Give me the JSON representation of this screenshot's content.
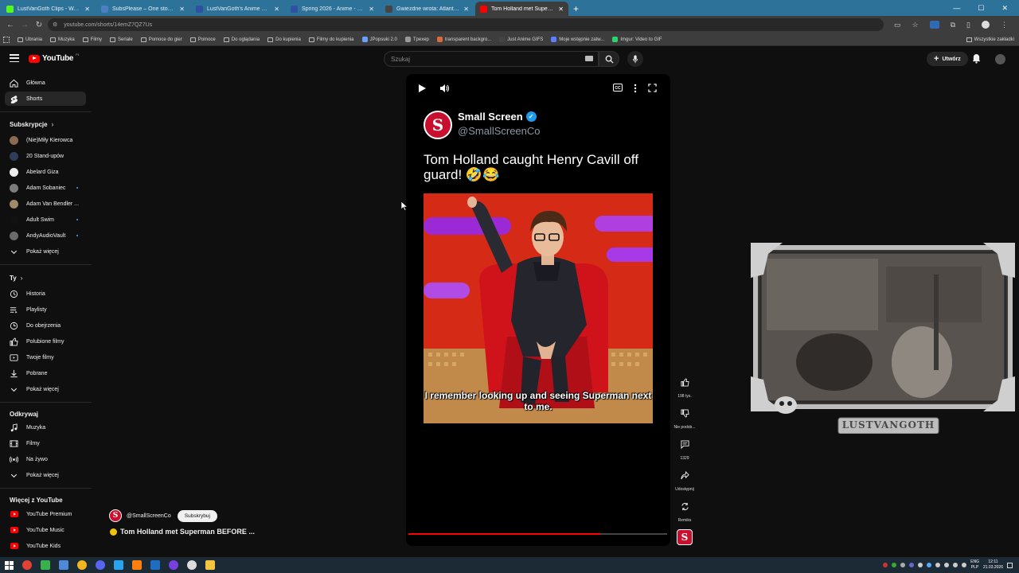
{
  "browser": {
    "tabs": [
      {
        "title": "LustVanGoth Clips - Watch Live",
        "fav_color": "#53fc18",
        "active": false
      },
      {
        "title": "SubsPlease – One stop shop fo",
        "fav_color": "#4a7fc1",
        "active": false
      },
      {
        "title": "LustVanGoth's Anime List - My",
        "fav_color": "#2e51a2",
        "active": false
      },
      {
        "title": "Spring 2026 - Anime - MyAnim",
        "fav_color": "#2e51a2",
        "active": false
      },
      {
        "title": "Gwiezdne wrota: Atlantyda / St",
        "fav_color": "#444444",
        "active": false
      },
      {
        "title": "Tom Holland met Superman",
        "fav_color": "#ff0000",
        "active": true
      }
    ],
    "url": "youtube.com/shorts/14emZ7QZ7Us",
    "bookmarks": [
      {
        "label": "Ubrania",
        "type": "folder"
      },
      {
        "label": "Muzyka",
        "type": "folder"
      },
      {
        "label": "Filmy",
        "type": "folder"
      },
      {
        "label": "Seriale",
        "type": "folder"
      },
      {
        "label": "Pomoce do gier",
        "type": "folder"
      },
      {
        "label": "Pomoce",
        "type": "folder"
      },
      {
        "label": "Do oglądania",
        "type": "folder"
      },
      {
        "label": "Do kupienia",
        "type": "folder"
      },
      {
        "label": "Filmy do kupienia",
        "type": "folder"
      },
      {
        "label": "JPopsuki 2.0",
        "type": "site",
        "color": "#6aa0ff"
      },
      {
        "label": "Tpexep",
        "type": "site",
        "color": "#999999"
      },
      {
        "label": "transparent backgro...",
        "type": "site",
        "color": "#d86b3c"
      },
      {
        "label": "Just Anime GIFS",
        "type": "site",
        "color": "#444444"
      },
      {
        "label": "Moje wstępnie zatw...",
        "type": "site",
        "color": "#5b7fff"
      },
      {
        "label": "Imgur: Video to GIF",
        "type": "site",
        "color": "#2bd56a"
      }
    ],
    "bookmarks_right": "Wszystkie zakładki"
  },
  "youtube": {
    "logo_text": "YouTube",
    "country": "PL",
    "search_placeholder": "Szukaj",
    "create_label": "Utwórz",
    "sidebar": {
      "main": [
        {
          "label": "Główna",
          "icon": "home-icon"
        },
        {
          "label": "Shorts",
          "icon": "shorts-icon",
          "selected": true
        }
      ],
      "subs_heading": "Subskrypcje",
      "subscriptions": [
        {
          "label": "(Nie)Miły Kierowca",
          "color": "#8a6b4f",
          "dot": false
        },
        {
          "label": "20 Stand-upów",
          "color": "#2e3d5a",
          "dot": false
        },
        {
          "label": "Abelard Giza",
          "color": "#ededed",
          "dot": false
        },
        {
          "label": "Adam Sobaniec",
          "color": "#7c7c7c",
          "dot": true
        },
        {
          "label": "Adam Van Bendler ...",
          "color": "#a08a6a",
          "dot": false
        },
        {
          "label": "Adult Swim",
          "color": "#111111",
          "dot": true
        },
        {
          "label": "AndyAudioVault",
          "color": "#6a6a6a",
          "dot": true
        }
      ],
      "subs_more": "Pokaż więcej",
      "you_heading": "Ty",
      "you": [
        {
          "label": "Historia",
          "icon": "history-icon"
        },
        {
          "label": "Playlisty",
          "icon": "playlist-icon"
        },
        {
          "label": "Do obejrzenia",
          "icon": "watch-later-icon"
        },
        {
          "label": "Polubione filmy",
          "icon": "liked-icon"
        },
        {
          "label": "Twoje filmy",
          "icon": "your-videos-icon"
        },
        {
          "label": "Pobrane",
          "icon": "download-icon"
        }
      ],
      "you_more": "Pokaż więcej",
      "explore_heading": "Odkrywaj",
      "explore": [
        {
          "label": "Muzyka",
          "icon": "music-icon"
        },
        {
          "label": "Filmy",
          "icon": "film-icon"
        },
        {
          "label": "Na żywo",
          "icon": "live-icon"
        }
      ],
      "explore_more": "Pokaż więcej",
      "more_heading": "Więcej z YouTube",
      "more": [
        {
          "label": "YouTube Premium"
        },
        {
          "label": "YouTube Music"
        },
        {
          "label": "YouTube Kids"
        }
      ]
    },
    "short": {
      "tweet_name": "Small Screen",
      "tweet_handle": "@SmallScreenCo",
      "tweet_text": "Tom Holland caught Henry Cavill off guard! 🤣😂",
      "subtitle": "I remember looking up and seeing Superman next to me.",
      "progress": 0.74,
      "channel": "@SmallScreenCo",
      "subscribe": "Subskrybuj",
      "title": "Tom Holland met Superman BEFORE ..."
    },
    "actions": {
      "likes": "198 tys.",
      "dislike": "Nie podob...",
      "comments": "1329",
      "share": "Udostępnij",
      "remix": "Remiks"
    },
    "webcam_caption": "LUSTVANGOTH"
  },
  "taskbar": {
    "lang": "ENG",
    "lang2": "PLP",
    "time": "12:11",
    "date": "21.03.2026"
  }
}
